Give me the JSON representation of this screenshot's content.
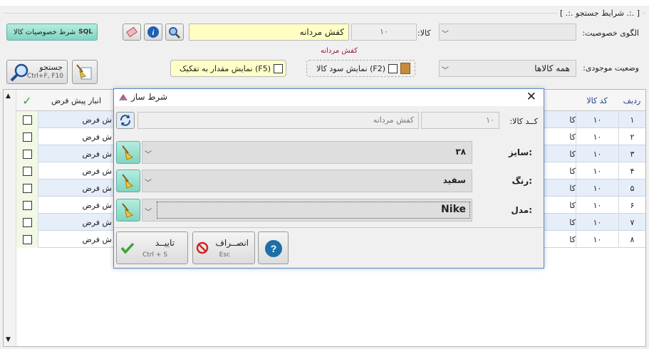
{
  "group_title": "[ .:. شرایط جستجو .:. ]",
  "attr_pattern_label": "الگوی خصوصیت:",
  "product_label": "کالا:",
  "product_code": "۱۰",
  "product_name": "کفش مردانه",
  "product_caption": "کفش مردانه",
  "attr_condition_button": "شرط خصوصیات کالا",
  "stock_status_label": "وضعیت موجودی:",
  "stock_status_value": "همه کالاها",
  "show_profit_label": "نمایش سود کالا (F2)",
  "show_qty_label": "نمایش مقدار به تفکیک (F5)",
  "search_button": "جستجو",
  "search_shortcut": "Ctrl+F, F10",
  "grid": {
    "headers": {
      "row": "ردیف",
      "code": "کد کالا",
      "warehouse": "انبار پیش فرض"
    },
    "rows": [
      {
        "num": "۱",
        "code": "۱۰",
        "name": "کا",
        "warehouse": "ش فرض"
      },
      {
        "num": "۲",
        "code": "۱۰",
        "name": "کا",
        "warehouse": "ش فرض"
      },
      {
        "num": "۳",
        "code": "۱۰",
        "name": "کا",
        "warehouse": "ش فرض"
      },
      {
        "num": "۴",
        "code": "۱۰",
        "name": "کا",
        "warehouse": "ش فرض"
      },
      {
        "num": "۵",
        "code": "۱۰",
        "name": "کا",
        "warehouse": "ش فرض"
      },
      {
        "num": "۶",
        "code": "۱۰",
        "name": "کا",
        "warehouse": "ش فرض"
      },
      {
        "num": "۷",
        "code": "۱۰",
        "name": "کا",
        "warehouse": "ش فرض"
      },
      {
        "num": "۸",
        "code": "۱۰",
        "name": "کا",
        "warehouse": "ش فرض"
      }
    ]
  },
  "dialog": {
    "title": "شرط ساز",
    "code_label": "کــد کالا:",
    "code_value": "۱۰",
    "name_value": "کفش مردانه",
    "size_label": "سایز:",
    "size_value": "۳۸",
    "color_label": "رنگ:",
    "color_value": "سفید",
    "model_label": "مدل:",
    "model_value": "Nike",
    "confirm_label": "تاییــد",
    "confirm_shortcut": "Ctrl + S",
    "cancel_label": "انصــراف",
    "cancel_shortcut": "Esc"
  }
}
